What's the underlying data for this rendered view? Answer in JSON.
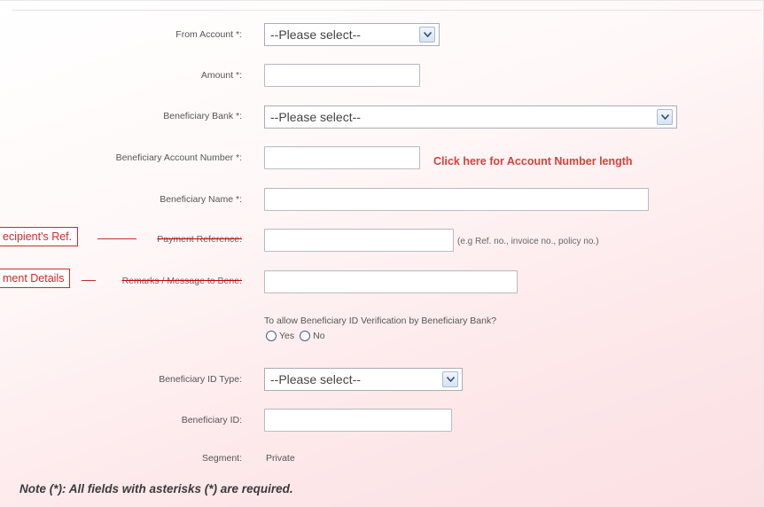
{
  "form": {
    "from_account": {
      "label": "From Account *:",
      "value": "--Please select--"
    },
    "amount": {
      "label": "Amount *:",
      "value": ""
    },
    "beneficiary_bank": {
      "label": "Beneficiary Bank *:",
      "value": "--Please select--"
    },
    "beneficiary_account_number": {
      "label": "Beneficiary Account Number *:",
      "value": "",
      "link": "Click here for Account Number length"
    },
    "beneficiary_name": {
      "label": "Beneficiary Name *:",
      "value": ""
    },
    "payment_reference": {
      "label": "Payment Reference:",
      "value": "",
      "hint": "(e.g Ref. no., invoice no., policy no.)"
    },
    "remarks": {
      "label": "Remarks / Message to Bene:",
      "value": ""
    },
    "id_verification": {
      "question": "To allow Beneficiary ID Verification by Beneficiary Bank?",
      "options": [
        "Yes",
        "No"
      ]
    },
    "beneficiary_id_type": {
      "label": "Beneficiary ID Type:",
      "value": "--Please select--"
    },
    "beneficiary_id": {
      "label": "Beneficiary ID:",
      "value": ""
    },
    "segment": {
      "label": "Segment:",
      "value": "Private"
    }
  },
  "callouts": {
    "recipients_ref": "ecipient's Ref.",
    "payment_details": "ment Details"
  },
  "note": "Note (*): All fields with asterisks (*) are required.",
  "colors": {
    "link_red": "#d9413b",
    "callout_red": "#cc2a2a",
    "background_pink": "#fbe0e3"
  }
}
